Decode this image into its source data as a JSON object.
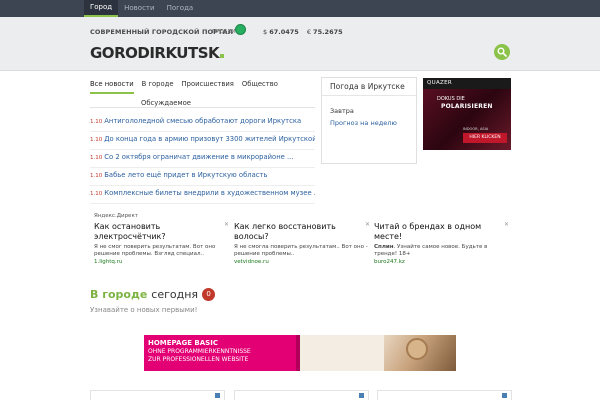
{
  "top_nav": {
    "items": [
      {
        "label": "Город",
        "active": true
      },
      {
        "label": "Новости",
        "active": false
      },
      {
        "label": "Погода",
        "active": false
      }
    ]
  },
  "header": {
    "tagline": "СОВРЕМЕННЫЙ ГОРОДСКОЙ ПОРТАЛ",
    "traffic_label": "ПРОБКИ",
    "traffic_color": "#27ae60",
    "rates": {
      "usd_symbol": "$",
      "usd_value": "67.0475",
      "eur_symbol": "€",
      "eur_value": "75.2675"
    },
    "logo": "GORODIRKUTSK"
  },
  "news_tabs": {
    "tabs": [
      "Все новости",
      "В городе",
      "Происшествия",
      "Общество"
    ],
    "second_row": "Обсуждаемое"
  },
  "news": [
    {
      "date": "1.10",
      "title": "Антигололедной смесью обработают дороги Иркутска"
    },
    {
      "date": "1.10",
      "title": "До конца года в армию призовут 3300 жителей Иркутской ..."
    },
    {
      "date": "1.10",
      "title": "Со 2 октября ограничат движение в микрорайоне ..."
    },
    {
      "date": "1.10",
      "title": "Бабье лето ещё придет в Иркутскую область"
    },
    {
      "date": "1.10",
      "title": "Комплексные билеты внедрили в художественном музее ..."
    }
  ],
  "weather": {
    "title": "Погода в Иркутске",
    "tomorrow": "Завтра",
    "week_link": "Прогноз на неделю"
  },
  "ad_right": {
    "brand": "QUAZER",
    "tagline": "DOKUS DIE",
    "headline": "POLARISIEREN",
    "small": "INDOOR, ASIA",
    "button": "HIER KLICKEN"
  },
  "direct": {
    "label": "Яндекс.Директ",
    "ads": [
      {
        "title": "Как остановить электросчётчик?",
        "text": "Я не смог поверить результатам. Вот оно решение проблемы. Взгляд специал..",
        "url": "1.lightq.ru"
      },
      {
        "title": "Как легко восстановить волосы?",
        "text": "Я не смогла поверить результатам.. Вот оно - решение проблемы..",
        "url": "vetvidnoe.ru"
      },
      {
        "title": "Читай о брендах в одном месте!",
        "brand": "Сплин",
        "text": ". Узнайте самое новое. Будьте в тренде! 18+",
        "url": "buro247.kz"
      }
    ]
  },
  "section": {
    "title_green": "В городе",
    "title_dark": "сегодня",
    "count": "0",
    "subtitle": "Узнавайте о новых первыми!"
  },
  "banner": {
    "line1": "HOMEPAGE BASIC",
    "line2": "OHNE PROGRAMMIERKENNTNISSE",
    "line3": "ZUR PROFESSIONELLEN WEBSITE"
  },
  "colors": {
    "accent": "#8bc34a",
    "topbar": "#3d4452",
    "link": "#2a5f9e",
    "date": "#c0392b"
  }
}
